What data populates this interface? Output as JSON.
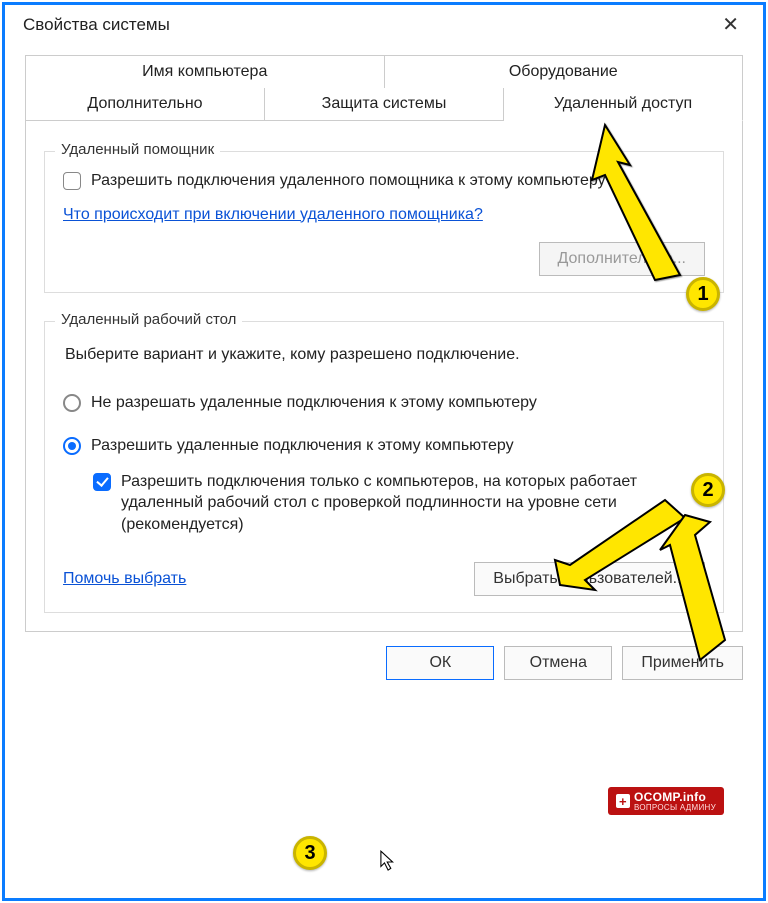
{
  "window": {
    "title": "Свойства системы"
  },
  "tabs": {
    "row1": [
      "Имя компьютера",
      "Оборудование"
    ],
    "row2": [
      "Дополнительно",
      "Защита системы",
      "Удаленный доступ"
    ]
  },
  "group1": {
    "title": "Удаленный помощник",
    "checkbox_label": "Разрешить подключения удаленного помощника к этому компьютеру",
    "link": "Что происходит при включении удаленного помощника?",
    "advanced_btn": "Дополнительно..."
  },
  "group2": {
    "title": "Удаленный рабочий стол",
    "desc": "Выберите вариант и укажите, кому разрешено подключение.",
    "radio1": "Не разрешать удаленные подключения к этому компьютеру",
    "radio2": "Разрешить удаленные подключения к этому компьютеру",
    "nla_checkbox": "Разрешить подключения только с компьютеров, на которых работает удаленный рабочий стол с проверкой подлинности на уровне сети (рекомендуется)",
    "help_link": "Помочь выбрать",
    "select_users_btn": "Выбрать пользователей..."
  },
  "buttons": {
    "ok": "ОК",
    "cancel": "Отмена",
    "apply": "Применить"
  },
  "annotations": {
    "b1": "1",
    "b2": "2",
    "b3": "3"
  },
  "watermark": {
    "main": "OCOMP.info",
    "sub": "ВОПРОСЫ АДМИНУ"
  }
}
